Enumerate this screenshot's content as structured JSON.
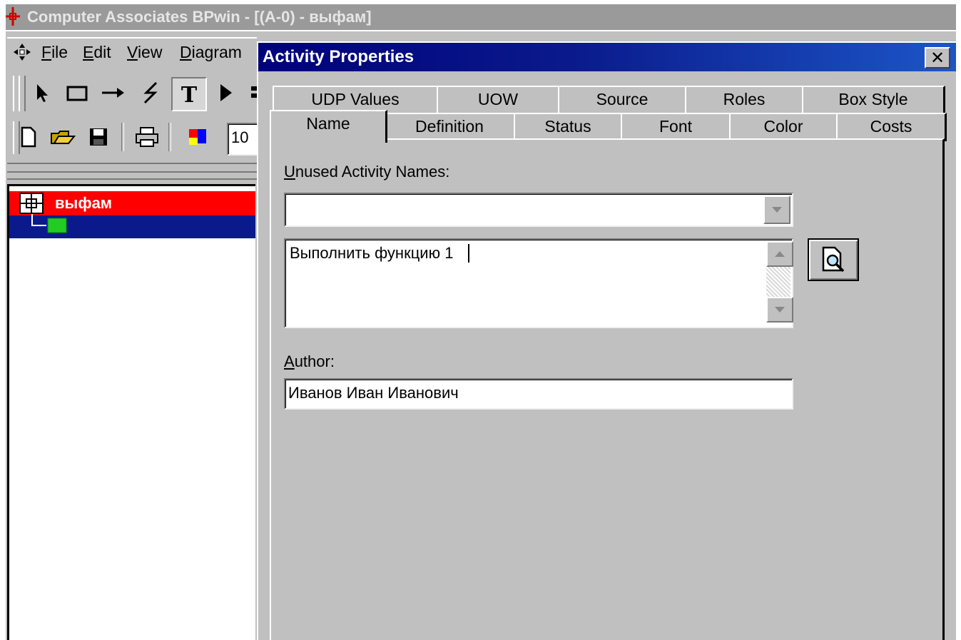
{
  "app": {
    "title": "Computer Associates BPwin - [(A-0)  - выфам]",
    "icon": "bpwin-app-icon"
  },
  "menubar": {
    "items": [
      "File",
      "Edit",
      "View",
      "Diagram"
    ]
  },
  "toolbar": {
    "tools": [
      "pointer-icon",
      "box-tool-icon",
      "arrow-tool-icon",
      "squiggle-tool-icon",
      "text-tool-icon",
      "play-icon"
    ],
    "file_tools": [
      "new-doc-icon",
      "open-folder-icon",
      "save-icon",
      "print-icon",
      "color-palette-icon"
    ],
    "zoom_value": "10"
  },
  "tree": {
    "root_label": "выфам"
  },
  "dialog": {
    "title": "Activity Properties",
    "close_glyph": "✕",
    "tabs_back": [
      "UDP Values",
      "UOW",
      "Source",
      "Roles",
      "Box Style"
    ],
    "tabs_front": [
      "Name",
      "Definition",
      "Status",
      "Font",
      "Color",
      "Costs"
    ],
    "active_tab": "Name",
    "unused_names_label": "Unused Activity Names:",
    "unused_names_value": "",
    "name_value": "Выполнить функцию 1",
    "author_label": "Author:",
    "author_value": "Иванов Иван Иванович"
  },
  "colors": {
    "titlebar_active": "#0a1a8c",
    "tree_selected": "#ff0000",
    "tree_highlight": "#0a1a8c",
    "face": "#c0c0c0"
  }
}
